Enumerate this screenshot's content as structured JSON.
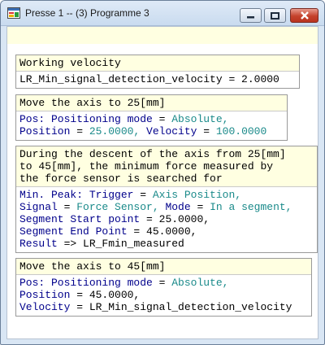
{
  "window": {
    "title": "Presse 1 -- (3) Programme 3"
  },
  "blocks": [
    {
      "header": [
        "Working velocity"
      ],
      "lines": [
        [
          "LR_Min_signal_detection_velocity",
          " = ",
          "2.0000"
        ]
      ]
    },
    {
      "header": [
        "Move the axis to 25[mm]"
      ],
      "lines": [
        [
          "Pos: Positioning mode",
          " = ",
          "Absolute,"
        ],
        [
          "Position",
          " = ",
          "25.0000, ",
          "Velocity",
          " = ",
          "100.0000"
        ]
      ]
    },
    {
      "header": [
        "During the descent of the axis from 25[mm]",
        "to 45[mm], the minimum force measured by",
        "the force sensor is searched for"
      ],
      "lines": [
        [
          "Min. Peak: Trigger",
          " = ",
          "Axis Position,"
        ],
        [
          "Signal",
          " = ",
          "Force Sensor, ",
          "Mode",
          " = ",
          "In a segment,"
        ],
        [
          "Segment Start point",
          " = ",
          "25.0000,"
        ],
        [
          "Segment End Point",
          " = ",
          "45.0000,"
        ],
        [
          "Result",
          " => ",
          "LR_Fmin_measured"
        ]
      ]
    },
    {
      "header": [
        "Move the axis to 45[mm]"
      ],
      "lines": [
        [
          "Pos: Positioning mode",
          " = ",
          "Absolute,"
        ],
        [
          "Position",
          " = ",
          "45.0000,"
        ],
        [
          "Velocity",
          " = ",
          "LR_Min_signal_detection_velocity"
        ]
      ]
    }
  ]
}
